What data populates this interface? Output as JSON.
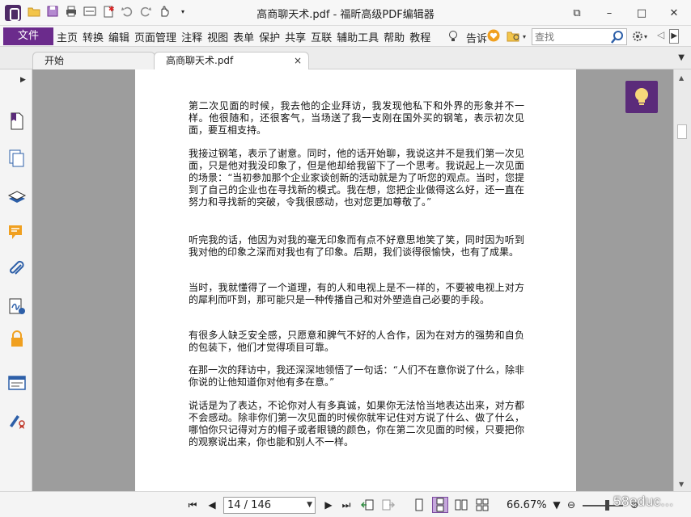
{
  "window": {
    "title": "高商聊天术.pdf - 福昕高级PDF编辑器",
    "minimize_glyph": "⧉",
    "restore_glyph": "–",
    "maximize_glyph": "□",
    "close_glyph": "✕"
  },
  "quick_access": {
    "icons": [
      "open-folder-icon",
      "save-icon",
      "print-icon",
      "scan-icon",
      "new-icon",
      "undo-icon",
      "redo-icon",
      "hand-tool-icon",
      "customize-dropdown-icon"
    ]
  },
  "menu": {
    "file_label": "文件",
    "items": [
      "主页",
      "转换",
      "编辑",
      "页面管理",
      "注释",
      "视图",
      "表单",
      "保护",
      "共享",
      "互联",
      "辅助工具",
      "帮助",
      "教程"
    ],
    "tell_me": "告诉",
    "search_placeholder": "查找"
  },
  "tabs": [
    {
      "label": "开始"
    },
    {
      "label": "高商聊天术.pdf",
      "close": "×"
    }
  ],
  "sidebar": {
    "icons": [
      "bookmark-icon",
      "pages-icon",
      "layers-icon",
      "comments-icon",
      "attachments-icon",
      "signatures-icon",
      "security-icon",
      "content-icon",
      "destinations-icon"
    ]
  },
  "document": {
    "paragraphs": [
      "第二次见面的时候，我去他的企业拜访，我发现他私下和外界的形象并不一样。他很随和，还很客气，当场送了我一支刚在国外买的钢笔，表示初次见面，要互相支持。",
      "我接过钢笔，表示了谢意。同时，他的话开始聊，我说这并不是我们第一次见面，只是他对我没印象了，但是他却给我留下了一个思考。我说起上一次见面的场景：“当初参加那个企业家谈创新的活动就是为了听您的观点。当时，您提到了自己的企业也在寻找新的模式。我在想，您把企业做得这么好，还一直在努力和寻找新的突破，令我很感动，也对您更加尊敬了。”",
      "听完我的话，他因为对我的毫无印象而有点不好意思地笑了笑，同时因为听到我对他的印象之深而对我也有了印象。后期，我们谈得很愉快，也有了成果。",
      "当时，我就懂得了一个道理，有的人和电视上是不一样的，不要被电视上对方的犀利而吓到，那可能只是一种传播自己和对外塑造自己必要的手段。",
      "有很多人缺乏安全感，只愿意和脾气不好的人合作，因为在对方的强势和自负的包装下，他们才觉得项目可靠。",
      "在那一次的拜访中，我还深深地领悟了一句话：“人们不在意你说了什么，除非你说的让他知道你对他有多在意。”",
      "说话是为了表达，不论你对人有多真诚，如果你无法恰当地表达出来，对方都不会感动。除非你们第一次见面的时候你就牢记住对方说了什么、做了什么，哪怕你只记得对方的帽子或者眼镜的颜色，你在第二次见面的时候，只要把你的观察说出来，你也能和别人不一样。"
    ]
  },
  "status": {
    "page_display": "14 / 146",
    "zoom": "66.67%",
    "watermark": "58educ..."
  },
  "colors": {
    "accent": "#6b2b8c",
    "doc_bg": "#9d9d9d",
    "heart": "#f0a020"
  }
}
